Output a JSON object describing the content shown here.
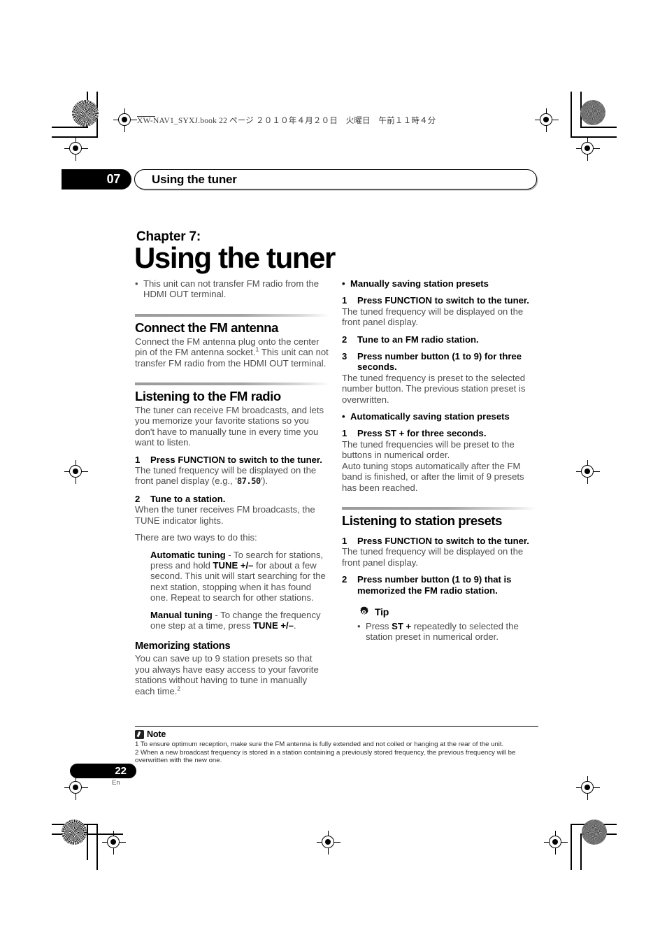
{
  "page": {
    "book_header": "XW-NAV1_SYXJ.book   22 ページ   ２０１０年４月２０日　火曜日　午前１１時４分",
    "page_number": "22",
    "language_code": "En"
  },
  "running_head": {
    "chapter_number": "07",
    "chapter_title": "Using the tuner"
  },
  "title_block": {
    "chapter_label": "Chapter 7:",
    "chapter_title": "Using the tuner",
    "intro_bullet": "This unit can not transfer FM radio from the HDMI OUT terminal."
  },
  "left_column": {
    "connect_antenna": {
      "heading": "Connect the FM antenna",
      "body_1": "Connect the FM antenna plug onto the center pin of the FM antenna socket.",
      "footnote_ref_1": "1",
      "body_2": " This unit can not transfer FM radio from the HDMI OUT terminal."
    },
    "listening_fm": {
      "heading": "Listening to the FM radio",
      "intro": "The tuner can receive FM broadcasts, and lets you memorize your favorite stations so you don't have to manually tune in every time you want to listen.",
      "step1_num": "1",
      "step1_title": "Press FUNCTION to switch to the tuner.",
      "step1_body_pre": "The tuned frequency will be displayed on the front panel display (e.g., '",
      "step1_body_freq": "87.50",
      "step1_body_post": "').",
      "step2_num": "2",
      "step2_title": "Tune to a station.",
      "step2_body": "When the tuner receives FM broadcasts, the TUNE indicator lights.",
      "ways_intro": "There are two ways to do this:",
      "auto_label": "Automatic tuning",
      "auto_body_1": " - To search for stations, press and hold ",
      "auto_key": "TUNE +/–",
      "auto_body_2": " for about a few second. This unit will start searching for the next station, stopping when it has found one. Repeat to search for other stations.",
      "manual_label": "Manual tuning",
      "manual_body_1": " - To change the frequency one step at a time, press ",
      "manual_key": "TUNE +/–",
      "manual_body_2": "."
    },
    "memorizing": {
      "heading": "Memorizing stations",
      "body": "You can save up to 9 station presets so that you always have easy access to your favorite stations without having to tune in manually each time.",
      "footnote_ref_2": "2"
    }
  },
  "right_column": {
    "manual_presets": {
      "bullet_title": "Manually saving station presets",
      "step1_num": "1",
      "step1_title": "Press FUNCTION to switch to the tuner.",
      "step1_body": "The tuned frequency will be displayed on the front panel display.",
      "step2_num": "2",
      "step2_title": "Tune to an FM radio station.",
      "step3_num": "3",
      "step3_title": "Press number button (1 to 9) for three seconds.",
      "step3_body": "The tuned frequency is preset to the selected number button. The previous station preset is overwritten."
    },
    "auto_presets": {
      "bullet_title": "Automatically saving station presets",
      "step1_num": "1",
      "step1_title": "Press ST + for three seconds.",
      "step1_body": "The tuned frequencies will be preset to the buttons in numerical order.",
      "step1_body_2": "Auto tuning stops automatically after the FM band is finished, or after the limit of 9 presets has been reached."
    },
    "listening_presets": {
      "heading": "Listening to station presets",
      "step1_num": "1",
      "step1_title": "Press FUNCTION to switch to the tuner.",
      "step1_body": "The tuned frequency will be displayed on the front panel display.",
      "step2_num": "2",
      "step2_title": "Press number button (1 to 9) that is memorized the FM radio station."
    },
    "tip": {
      "label": "Tip",
      "icon": "gear-icon",
      "bullet_pre": "Press ",
      "bullet_key": "ST +",
      "bullet_post": " repeatedly to selected the station preset in numerical order."
    }
  },
  "notes": {
    "label": "Note",
    "icon": "note-pencil-icon",
    "items": [
      "1 To ensure optimum reception, make sure the FM antenna is fully extended and not coiled or hanging at the rear of the unit.",
      "2 When a new broadcast frequency is stored in a station containing a previously stored frequency, the previous frequency will be overwritten with the new one."
    ]
  }
}
